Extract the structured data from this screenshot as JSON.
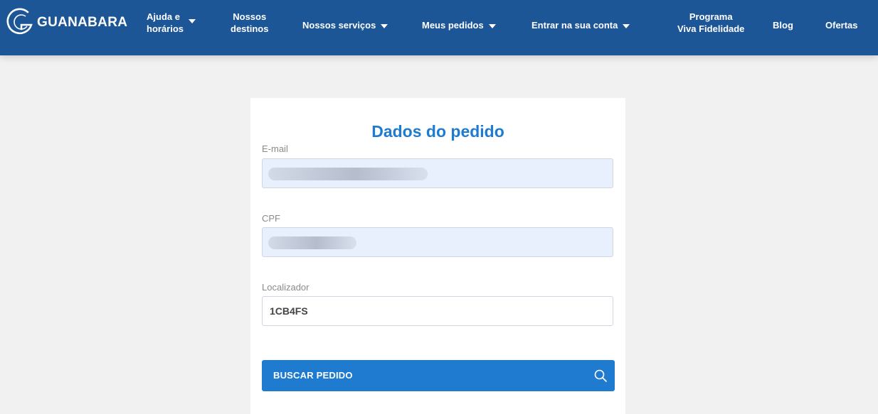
{
  "header": {
    "brand": "GUANABARA",
    "nav": [
      {
        "line1": "Ajuda e",
        "line2": "horários"
      },
      {
        "line1": "Nossos",
        "line2": "destinos"
      },
      {
        "line1": "Nossos serviços"
      },
      {
        "line1": "Meus pedidos"
      },
      {
        "line1": "Entrar na sua conta"
      },
      {
        "line1": "Programa",
        "line2": "Viva Fidelidade"
      },
      {
        "line1": "Blog"
      },
      {
        "line1": "Ofertas"
      }
    ]
  },
  "form": {
    "title": "Dados do pedido",
    "email": {
      "label": "E-mail",
      "value": ""
    },
    "cpf": {
      "label": "CPF",
      "value": ""
    },
    "locator": {
      "label": "Localizador",
      "value": "1CB4FS"
    },
    "submit_label": "BUSCAR PEDIDO"
  },
  "icons": {
    "brand": "guanabara-logo-icon",
    "dropdown": "caret-down-icon",
    "submit": "search-icon"
  },
  "colors": {
    "header_bg": "#1d5697",
    "accent": "#1f7bd0",
    "page_bg": "#f1f1f1",
    "autofill_bg": "#e8f0fe"
  }
}
